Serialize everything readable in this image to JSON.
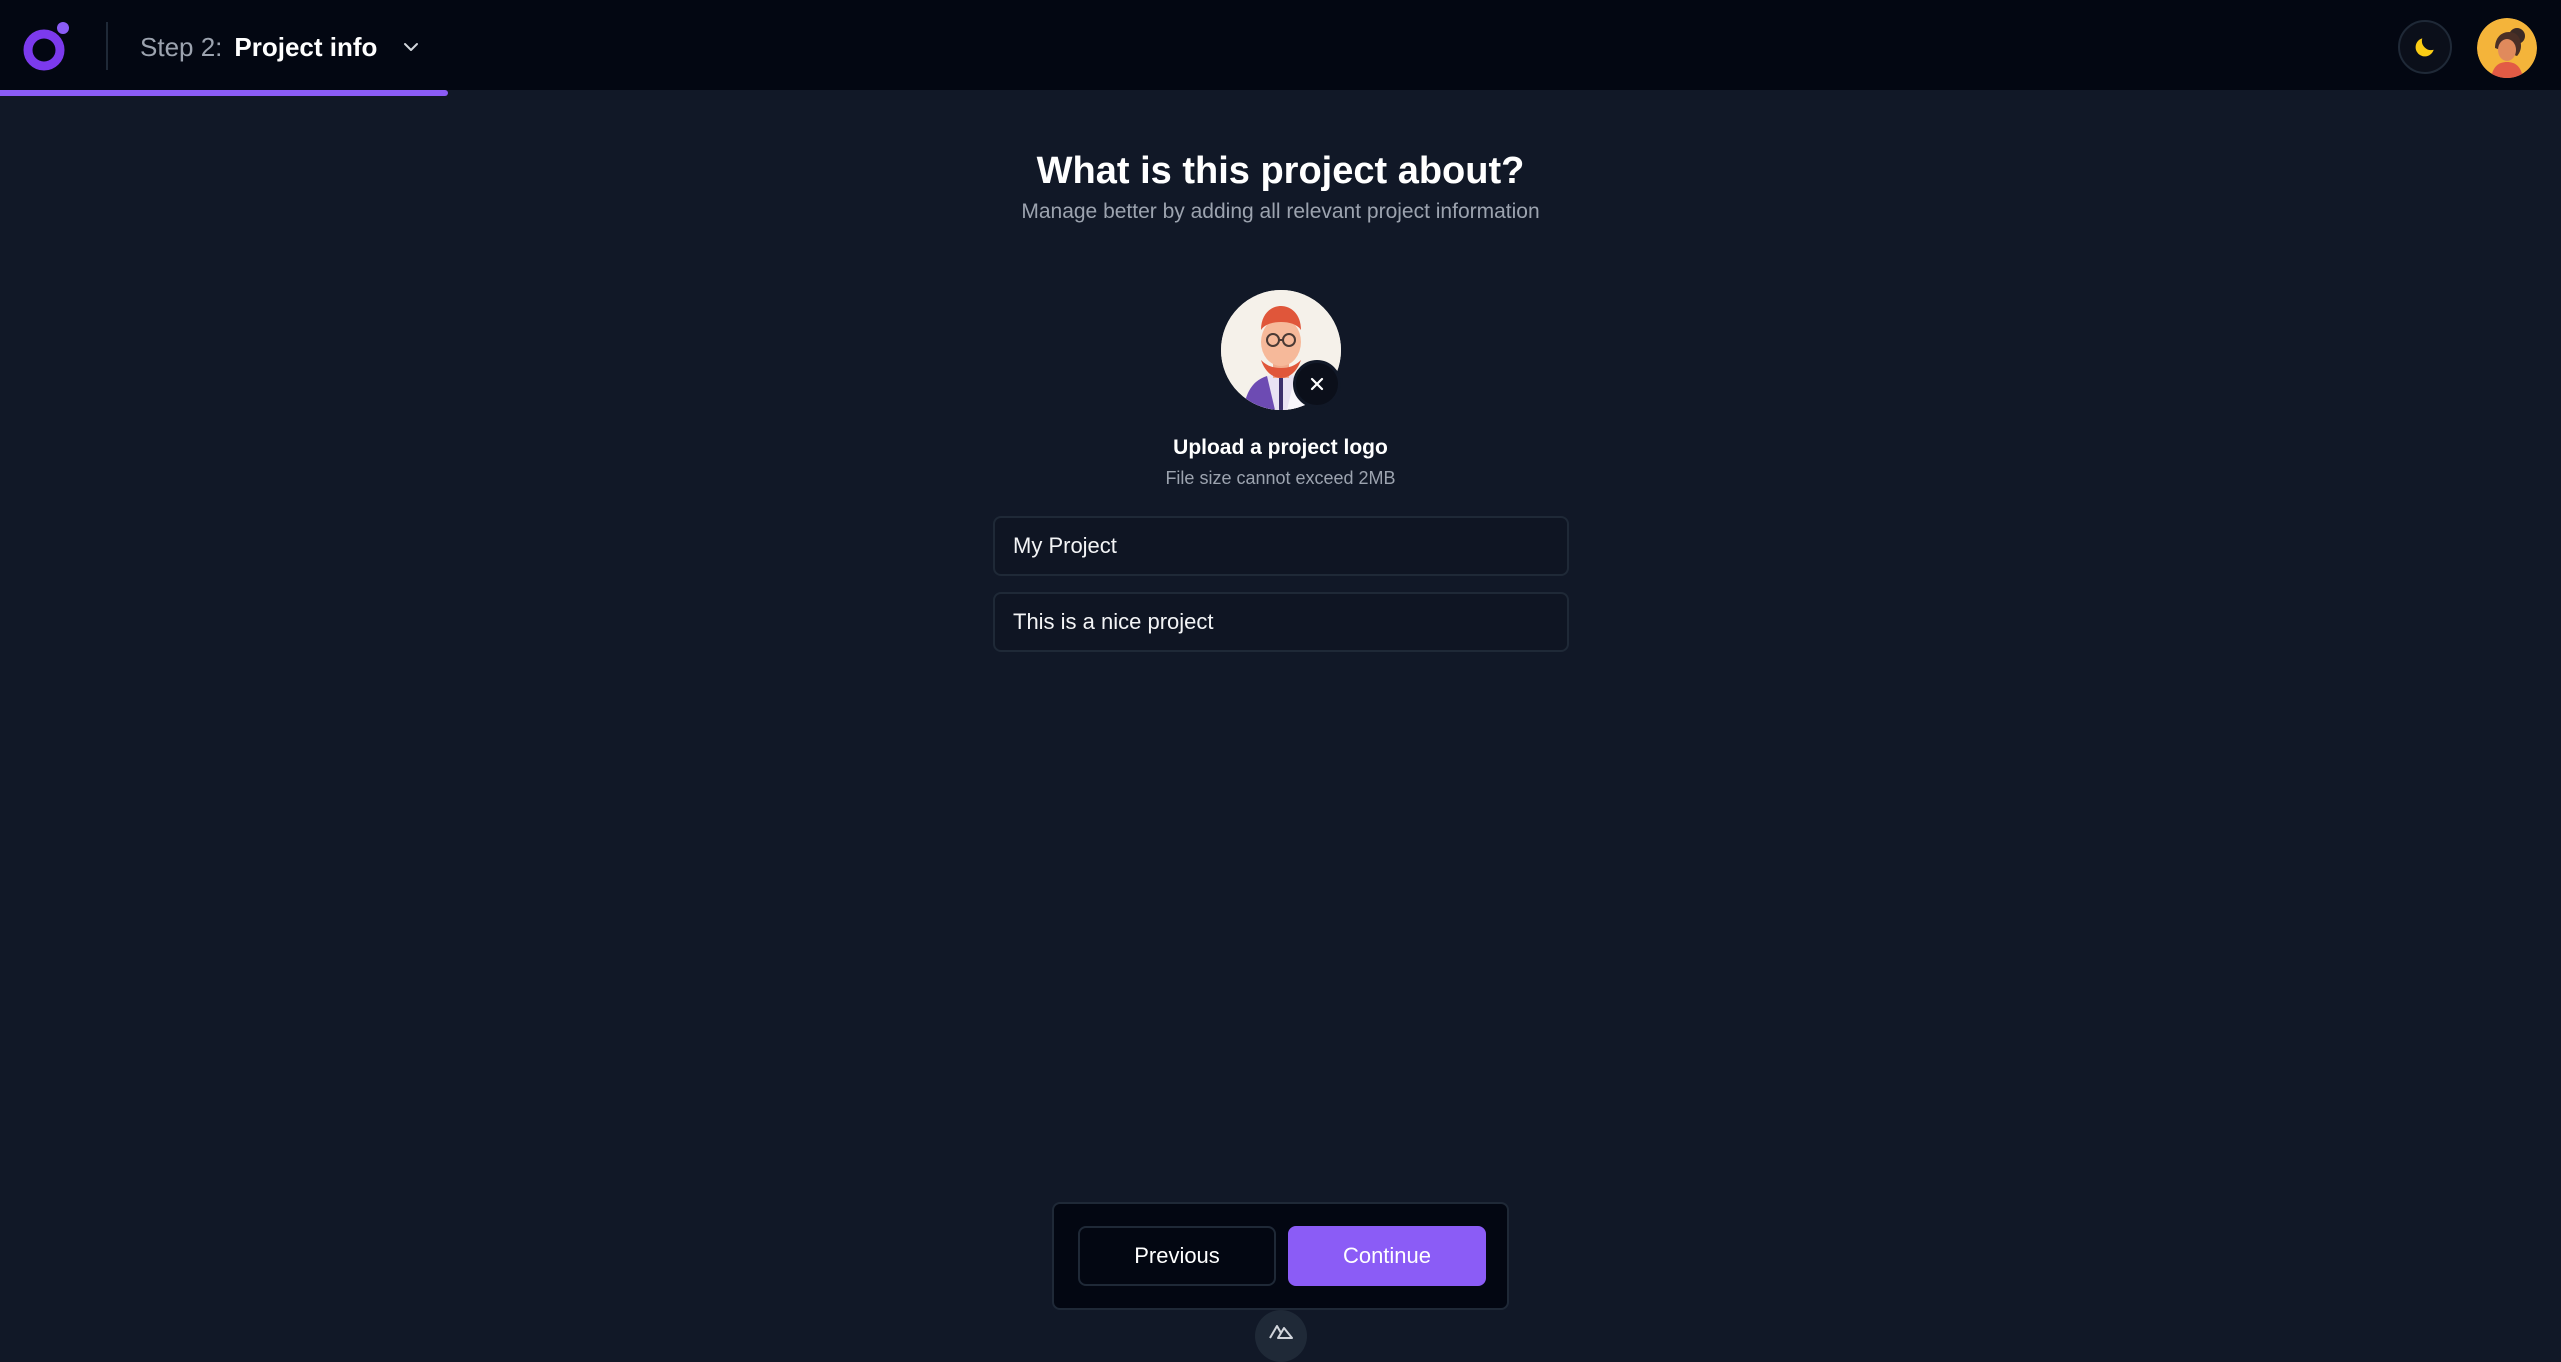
{
  "header": {
    "step_prefix": "Step 2:",
    "step_title": "Project info",
    "progress_fraction": 0.175
  },
  "main": {
    "title": "What is this project about?",
    "subtitle": "Manage better by adding all relevant project information",
    "upload_title": "Upload a project logo",
    "upload_hint": "File size cannot exceed 2MB",
    "project_name_value": "My Project",
    "project_description_value": "This is a nice project"
  },
  "footer": {
    "previous_label": "Previous",
    "continue_label": "Continue"
  },
  "colors": {
    "accent": "#8b5cf6",
    "background": "#111827",
    "topbar": "#030712",
    "moon": "#facc15"
  },
  "icons": {
    "logo": "brand-logo-icon",
    "chevron": "chevron-down-icon",
    "theme": "moon-icon",
    "remove": "close-icon",
    "dev": "nuxt-icon"
  }
}
